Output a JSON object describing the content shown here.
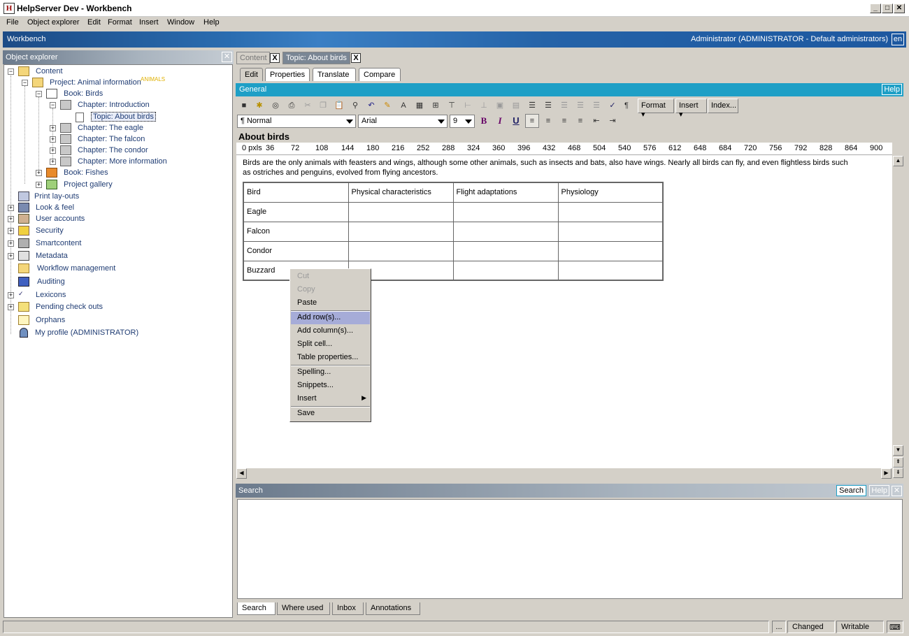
{
  "window": {
    "title": "HelpServer Dev - Workbench",
    "app_icon": "H"
  },
  "menu": [
    "File",
    "Object explorer",
    "Edit",
    "Format",
    "Insert",
    "Window",
    "Help"
  ],
  "workbench": {
    "title": "Workbench",
    "user": "Administrator (ADMINISTRATOR - Default administrators)",
    "lang": "en"
  },
  "explorer": {
    "title": "Object explorer",
    "nodes": [
      {
        "label": "Content"
      },
      {
        "label": "Project: Animal information",
        "tag": "ANIMALS"
      },
      {
        "label": "Book: Birds"
      },
      {
        "label": "Chapter: Introduction"
      },
      {
        "label": "Topic: About birds"
      },
      {
        "label": "Chapter: The eagle"
      },
      {
        "label": "Chapter: The falcon"
      },
      {
        "label": "Chapter: The condor"
      },
      {
        "label": "Chapter: More information"
      },
      {
        "label": "Book: Fishes"
      },
      {
        "label": "Project gallery"
      },
      {
        "label": "Print lay-outs"
      },
      {
        "label": "Look & feel"
      },
      {
        "label": "User accounts"
      },
      {
        "label": "Security"
      },
      {
        "label": "Smartcontent"
      },
      {
        "label": "Metadata"
      },
      {
        "label": "Workflow management"
      },
      {
        "label": "Auditing"
      },
      {
        "label": "Lexicons"
      },
      {
        "label": "Pending check outs"
      },
      {
        "label": "Orphans"
      },
      {
        "label": "My profile (ADMINISTRATOR)"
      }
    ]
  },
  "doc_tabs": [
    {
      "label": "Content"
    },
    {
      "label": "Topic: About birds"
    }
  ],
  "close_glyph": "X",
  "sub_tabs": [
    "Edit",
    "Properties",
    "Translate",
    "Compare"
  ],
  "general": {
    "title": "General",
    "help": "Help"
  },
  "toolbar": {
    "format": "Format",
    "insert": "Insert",
    "index": "Index...",
    "style": "Normal",
    "font": "Arial",
    "size": "9",
    "bold": "B",
    "italic": "I",
    "underline": "U",
    "pilcrow": "¶"
  },
  "doc": {
    "heading": "About birds",
    "ruler_unit": "0 pxls",
    "ruler": [
      "36",
      "72",
      "108",
      "144",
      "180",
      "216",
      "252",
      "288",
      "324",
      "360",
      "396",
      "432",
      "468",
      "504",
      "540",
      "576",
      "612",
      "648",
      "684",
      "720",
      "756",
      "792",
      "828",
      "864",
      "900"
    ],
    "paragraph": "Birds are the only animals with feasters and wings, although some other animals, such as insects and bats, also have wings. Nearly all birds can fly, and even flightless birds such as ostriches and penguins, evolved from flying ancestors.",
    "table": [
      [
        "Bird",
        "Physical characteristics",
        "Flight adaptations",
        "Physiology"
      ],
      [
        "Eagle",
        "",
        "",
        ""
      ],
      [
        "Falcon",
        "",
        "",
        ""
      ],
      [
        "Condor",
        "",
        "",
        ""
      ],
      [
        "Buzzard",
        "",
        "",
        ""
      ]
    ]
  },
  "context_menu": [
    "Cut",
    "Copy",
    "Paste",
    "Add row(s)...",
    "Add column(s)...",
    "Split cell...",
    "Table properties...",
    "Spelling...",
    "Snippets...",
    "Insert",
    "Save"
  ],
  "search": {
    "title": "Search",
    "search_btn": "Search",
    "help_btn": "Help"
  },
  "bottom_tabs": [
    "Search",
    "Where used",
    "Inbox",
    "Annotations"
  ],
  "status": {
    "dots": "...",
    "changed": "Changed",
    "writable": "Writable"
  }
}
